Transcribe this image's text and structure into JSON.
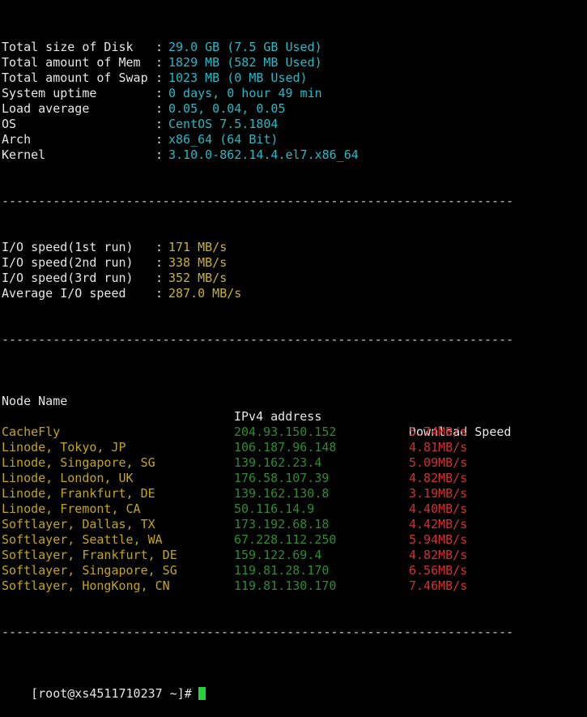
{
  "sysinfo": [
    {
      "label": "Total size of Disk",
      "value": "29.0 GB (7.5 GB Used)"
    },
    {
      "label": "Total amount of Mem",
      "value": "1829 MB (582 MB Used)"
    },
    {
      "label": "Total amount of Swap",
      "value": "1023 MB (0 MB Used)"
    },
    {
      "label": "System uptime",
      "value": "0 days, 0 hour 49 min"
    },
    {
      "label": "Load average",
      "value": "0.05, 0.04, 0.05"
    },
    {
      "label": "OS",
      "value": "CentOS 7.5.1804"
    },
    {
      "label": "Arch",
      "value": "x86_64 (64 Bit)"
    },
    {
      "label": "Kernel",
      "value": "3.10.0-862.14.4.el7.x86_64"
    }
  ],
  "separator_char": ":",
  "divider": "----------------------------------------------------------------------",
  "io": [
    {
      "label": "I/O speed(1st run)",
      "value": "171 MB/s"
    },
    {
      "label": "I/O speed(2nd run)",
      "value": "338 MB/s"
    },
    {
      "label": "I/O speed(3rd run)",
      "value": "352 MB/s"
    },
    {
      "label": "Average I/O speed",
      "value": "287.0 MB/s"
    }
  ],
  "speedtest": {
    "headers": {
      "node": "Node Name",
      "ip": "IPv4 address",
      "speed": "Download Speed"
    },
    "rows": [
      {
        "node": "CacheFly",
        "ip": "204.93.150.152",
        "speed": "5.74MB/s"
      },
      {
        "node": "Linode, Tokyo, JP",
        "ip": "106.187.96.148",
        "speed": "4.81MB/s"
      },
      {
        "node": "Linode, Singapore, SG",
        "ip": "139.162.23.4",
        "speed": "5.09MB/s"
      },
      {
        "node": "Linode, London, UK",
        "ip": "176.58.107.39",
        "speed": "4.82MB/s"
      },
      {
        "node": "Linode, Frankfurt, DE",
        "ip": "139.162.130.8",
        "speed": "3.19MB/s"
      },
      {
        "node": "Linode, Fremont, CA",
        "ip": "50.116.14.9",
        "speed": "4.40MB/s"
      },
      {
        "node": "Softlayer, Dallas, TX",
        "ip": "173.192.68.18",
        "speed": "4.42MB/s"
      },
      {
        "node": "Softlayer, Seattle, WA",
        "ip": "67.228.112.250",
        "speed": "5.94MB/s"
      },
      {
        "node": "Softlayer, Frankfurt, DE",
        "ip": "159.122.69.4",
        "speed": "4.82MB/s"
      },
      {
        "node": "Softlayer, Singapore, SG",
        "ip": "119.81.28.170",
        "speed": "6.56MB/s"
      },
      {
        "node": "Softlayer, HongKong, CN",
        "ip": "119.81.130.170",
        "speed": "7.46MB/s"
      }
    ]
  },
  "prompt": "[root@xs4511710237 ~]#",
  "colors": {
    "background": "#000000",
    "text": "#e6e6e6",
    "value_cyan": "#27b9c6",
    "value_yellow": "#c9b22f",
    "node_yellow": "#c2a615",
    "ip_green": "#2e8b2e",
    "speed_red": "#d03232",
    "cursor_green": "#22d43a"
  }
}
